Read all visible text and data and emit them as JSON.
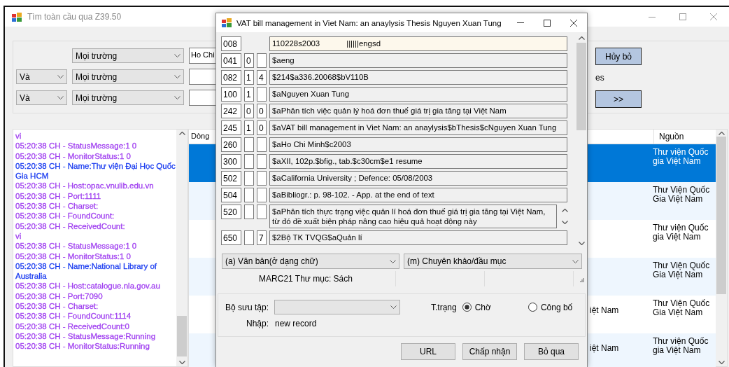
{
  "main_window": {
    "title": "Tìm toàn cầu qua Z39.50",
    "search_rows": [
      {
        "field": "Mọi trường",
        "value": "Ho Chi"
      },
      {
        "operator": "Và",
        "field": "Mọi trường"
      },
      {
        "operator": "Và",
        "field": "Mọi trường"
      }
    ],
    "cancel_button": "Hủy bỏ",
    "option_label": "es",
    "next_button": ">>",
    "log": [
      {
        "text": "vi",
        "color": "#a040f0"
      },
      {
        "text": "05:20:38 CH - StatusMessage:1 0",
        "color": "#a040f0"
      },
      {
        "text": "05:20:38 CH - MonitorStatus:1 0",
        "color": "#a040f0"
      },
      {
        "text": "05:20:38 CH - Name:Thư viện Đại Học Quốc Gia HCM",
        "color": "#1a3cf0"
      },
      {
        "text": "05:20:38 CH - Host:opac.vnulib.edu.vn",
        "color": "#a040f0"
      },
      {
        "text": "05:20:38 CH - Port:1111",
        "color": "#a040f0"
      },
      {
        "text": "05:20:38 CH - Charset:",
        "color": "#a040f0"
      },
      {
        "text": "05:20:38 CH - FoundCount:",
        "color": "#a040f0"
      },
      {
        "text": "05:20:38 CH - ReceivedCount:",
        "color": "#a040f0"
      },
      {
        "text": "vi",
        "color": "#a040f0"
      },
      {
        "text": "05:20:38 CH - StatusMessage:1 0",
        "color": "#a040f0"
      },
      {
        "text": "05:20:38 CH - MonitorStatus:1 0",
        "color": "#a040f0"
      },
      {
        "text": "05:20:38 CH - Name:National Library of Australia",
        "color": "#1a3cf0"
      },
      {
        "text": "05:20:38 CH - Host:catalogue.nla.gov.au",
        "color": "#a040f0"
      },
      {
        "text": "05:20:38 CH - Port:7090",
        "color": "#a040f0"
      },
      {
        "text": "05:20:38 CH - Charset:",
        "color": "#a040f0"
      },
      {
        "text": "05:20:38 CH - FoundCount:1114",
        "color": "#a040f0"
      },
      {
        "text": "05:20:38 CH - ReceivedCount:0",
        "color": "#a040f0"
      },
      {
        "text": "05:20:38 CH - StatusMessage:Running",
        "color": "#a040f0"
      },
      {
        "text": "05:20:38 CH - MonitorStatus:Running",
        "color": "#a040f0"
      }
    ],
    "grid": {
      "columns": [
        "Dòng",
        "Nguồn"
      ],
      "rows": [
        {
          "selected": true,
          "source": "Thư viện Quốc gia Việt Nam"
        },
        {
          "selected": false,
          "source": "Thư Viện Quốc Gia Việt Nam"
        },
        {
          "selected": false,
          "source": "Thư viện Quốc gia Việt Nam"
        },
        {
          "selected": false,
          "source": "Thư Viện Quốc Gia Việt Nam"
        },
        {
          "selected": false,
          "column_2": "iệt Nam",
          "source": "Thư Viện Quốc Gia Việt Nam"
        },
        {
          "selected": false,
          "column_2": "iệt Nam",
          "source": "Thư viện Quốc gia Việt Nam"
        }
      ]
    }
  },
  "dialog": {
    "title": "VAT bill management in Viet Nam: an anaylysis Thesis Nguyen Xuan Tung",
    "fields": [
      {
        "kind": "control",
        "tag": "008",
        "value": "110228s2003            ||||||engsd"
      },
      {
        "kind": "data",
        "tag": "041",
        "ind1": "0",
        "value": "$aeng"
      },
      {
        "kind": "data",
        "tag": "082",
        "ind1": "1",
        "ind2": "4",
        "value": "$214$a336.20068$bV110B"
      },
      {
        "kind": "data",
        "tag": "100",
        "ind1": "1",
        "value": "$aNguyen Xuan Tung"
      },
      {
        "kind": "data",
        "tag": "242",
        "ind1": "0",
        "ind2": "0",
        "value": "$aPhân tích việc quản lý hoá đơn thuế giá trị gia tăng tại Việt Nam"
      },
      {
        "kind": "data",
        "tag": "245",
        "ind1": "1",
        "ind2": "0",
        "value": "$aVAT bill management in Viet Nam: an anaylysis$bThesis$cNguyen Xuan Tung"
      },
      {
        "kind": "data",
        "tag": "260",
        "value": "$aHo Chi Minh$c2003"
      },
      {
        "kind": "data",
        "tag": "300",
        "value": "$aXII, 102p.$bfig., tab.$c30cm$e1 resume"
      },
      {
        "kind": "data",
        "tag": "502",
        "value": "$aCalifornia University ; Defence: 05/08/2003"
      },
      {
        "kind": "data",
        "tag": "504",
        "value": "$aBibliogr.: p. 98-102. - App. at the end of text"
      },
      {
        "kind": "multiline",
        "tag": "520",
        "value": "$aPhân tích thực trạng việc quản lí hoá đơn thuế giá trị gia tăng tại Việt Nam, từ đó đề xuất biện pháp nâng cao hiệu quả hoạt động này"
      },
      {
        "kind": "data",
        "tag": "650",
        "ind2": "7",
        "value": "$2Bộ TK TVQG$aQuản lí"
      }
    ],
    "type_select": "(a) Văn bản(ở dạng chữ)",
    "level_select": "(m) Chuyên khảo/đầu mục",
    "status_bar": "MARC21 Thư mục: Sách",
    "collection_label": "Bộ sưu tập:",
    "status_label": "T.trạng",
    "status_options": [
      {
        "label": "Chờ",
        "selected": true
      },
      {
        "label": "Công bố",
        "selected": false
      }
    ],
    "entry_label": "Nhập:",
    "entry_value": "new record",
    "buttons": [
      "URL",
      "Chấp nhận",
      "Bỏ qua"
    ]
  }
}
